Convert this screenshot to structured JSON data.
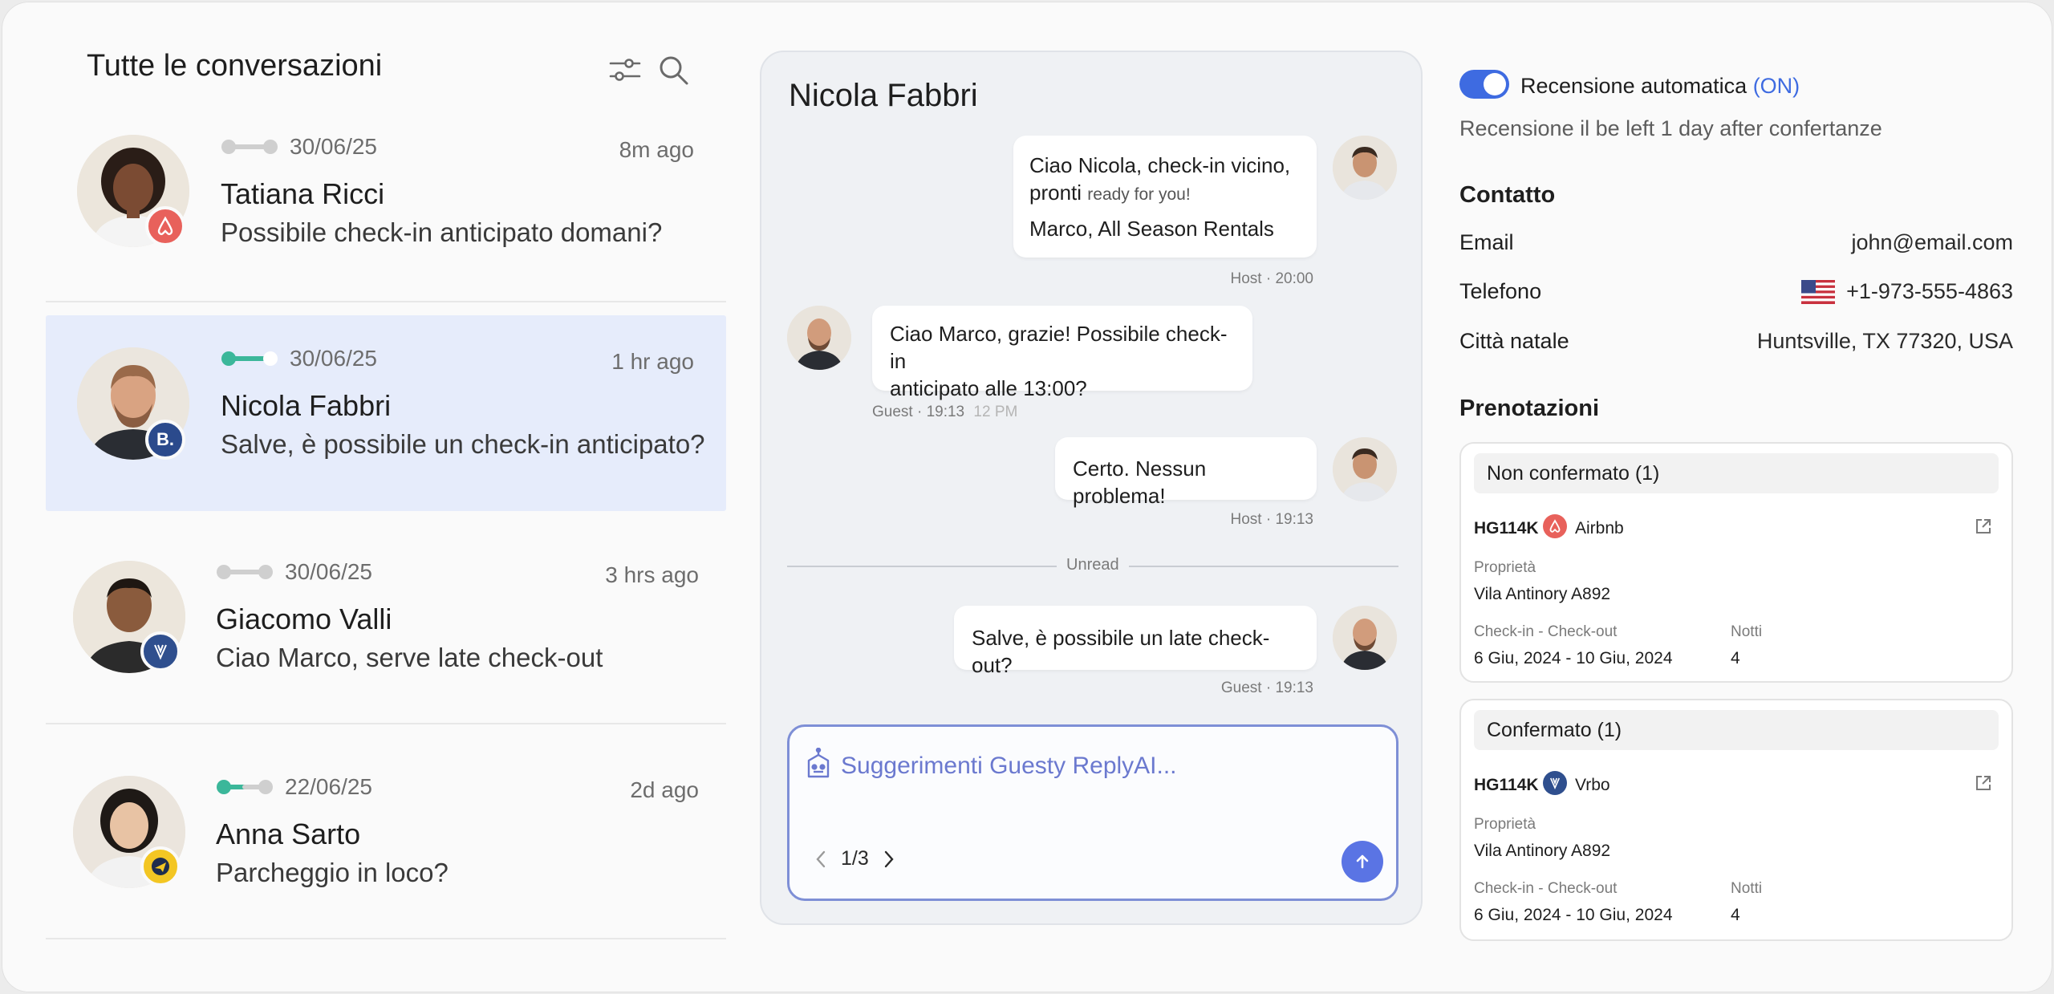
{
  "sidebar": {
    "title": "Tutte le conversazioni",
    "conversations": [
      {
        "date": "30/06/25",
        "ago": "8m ago",
        "name": "Tatiana Ricci",
        "message": "Possibile check-in anticipato domani?",
        "platform": "airbnb-icon",
        "status": "grey"
      },
      {
        "date": "30/06/25",
        "ago": "1 hr ago",
        "name": "Nicola Fabbri",
        "message": "Salve, è possibile un check-in anticipato?",
        "platform": "booking-icon",
        "badge_text": "B.",
        "status": "teal-half",
        "active": true
      },
      {
        "date": "30/06/25",
        "ago": "3 hrs ago",
        "name": "Giacomo Valli",
        "message": "Ciao Marco, serve late check-out",
        "platform": "vrbo-icon",
        "status": "grey"
      },
      {
        "date": "22/06/25",
        "ago": "2d ago",
        "name": "Anna Sarto",
        "message": "Parcheggio in loco?",
        "platform": "expedia-icon",
        "status": "teal"
      }
    ]
  },
  "chat": {
    "title": "Nicola Fabbri",
    "messages": [
      {
        "line1": "Ciao Nicola, check-in vicino,",
        "line2a": "pronti ",
        "line2b": "ready for you!",
        "line3": "Marco, All Season Rentals",
        "meta": "Host · 20:00"
      },
      {
        "line1": "Ciao Marco, grazie! Possibile check-in",
        "line2": "anticipato alle 13:00?",
        "meta": "Guest · 19:13",
        "meta_extra": "12 PM"
      },
      {
        "text": "Certo. Nessun problema!",
        "meta": "Host · 19:13"
      },
      {
        "text": "Salve, è possibile un late check-out?",
        "meta": "Guest · 19:13"
      }
    ],
    "divider_label": "Unread",
    "reply_placeholder": "Suggerimenti Guesty ReplyAI...",
    "pager": "1/3"
  },
  "details": {
    "auto_review_label": "Recensione automatica",
    "auto_review_state": "(ON)",
    "auto_review_note": "Recensione il be left 1 day after confertanze",
    "contact_title": "Contatto",
    "contact": {
      "email_label": "Email",
      "email": "john@email.com",
      "phone_label": "Telefono",
      "phone": "+1-973-555-4863",
      "city_label": "Città natale",
      "city": "Huntsville, TX 77320, USA"
    },
    "bookings_title": "Prenotazioni",
    "bookings": [
      {
        "status": "Non confermato (1)",
        "code": "HG114K",
        "platform": "Airbnb",
        "property_label": "Proprietà",
        "property": "Vila Antinory A892",
        "dates_label": "Check-in - Check-out",
        "dates": "6 Giu, 2024 - 10 Giu, 2024",
        "nights_label": "Notti",
        "nights": "4"
      },
      {
        "status": "Confermato (1)",
        "code": "HG114K",
        "platform": "Vrbo",
        "property_label": "Proprietà",
        "property": "Vila Antinory A892",
        "dates_label": "Check-in - Check-out",
        "dates": "6 Giu, 2024 - 10 Giu, 2024",
        "nights_label": "Notti",
        "nights": "4"
      }
    ]
  },
  "colors": {
    "accent": "#3e6be1",
    "active_row": "#e6ecfb",
    "airbnb": "#e8615b",
    "booking": "#2b4a8c",
    "vrbo": "#2f4f8e",
    "expedia": "#f3c623",
    "status_teal": "#3bb79a"
  }
}
